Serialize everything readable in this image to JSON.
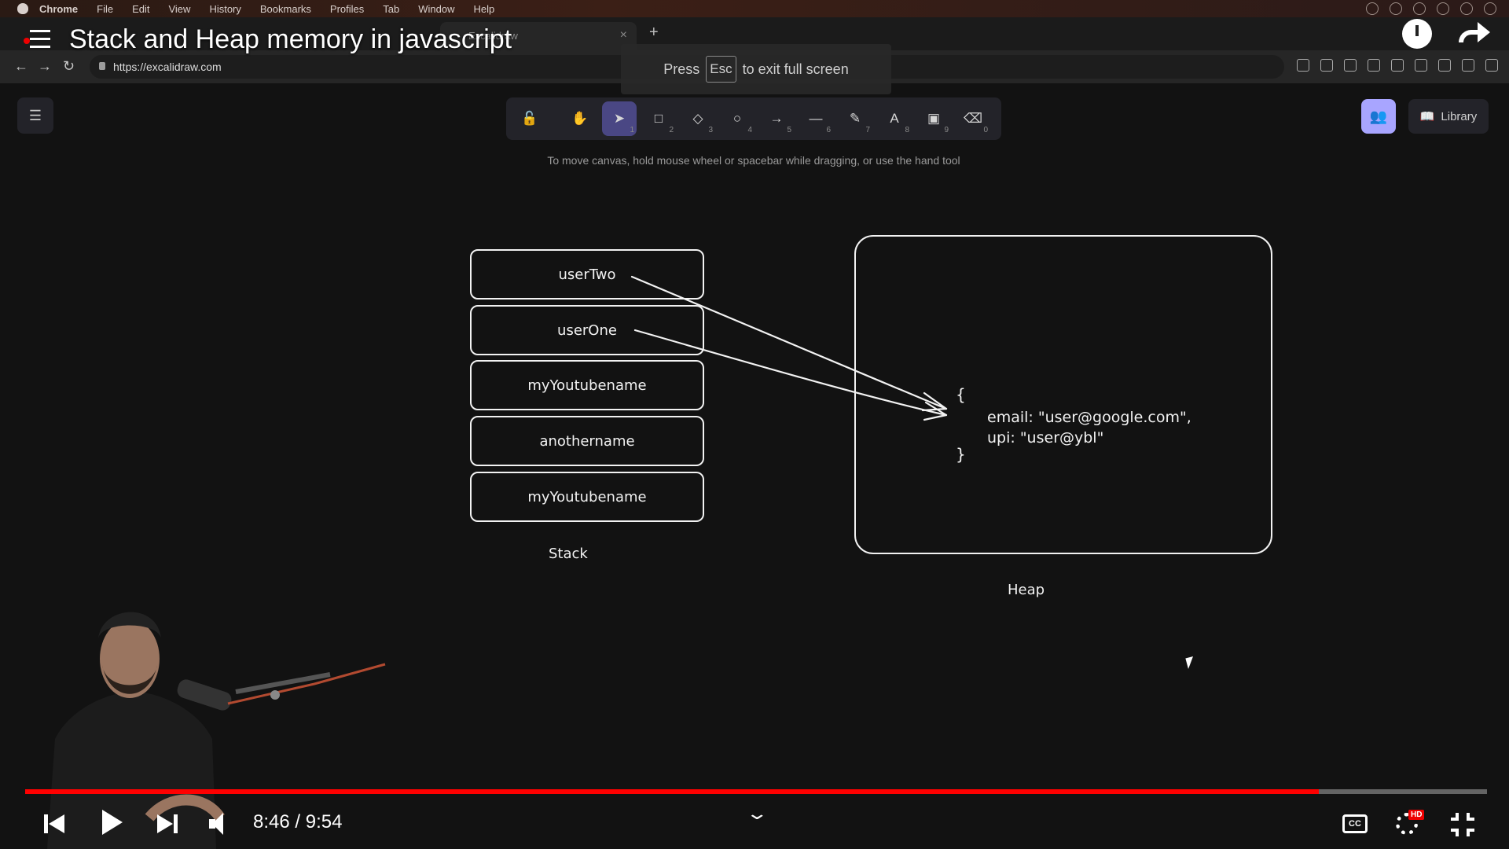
{
  "menubar": {
    "app": "Chrome",
    "items": [
      "File",
      "Edit",
      "View",
      "History",
      "Bookmarks",
      "Profiles",
      "Tab",
      "Window",
      "Help"
    ]
  },
  "browser": {
    "tab_label": "Excalidraw",
    "url": "https://excalidraw.com"
  },
  "fullscreen_hint": {
    "press": "Press",
    "key": "Esc",
    "rest": "to exit full screen"
  },
  "video": {
    "title": "Stack and Heap memory in javascript",
    "time": "8:46 / 9:54",
    "progress": 0.885,
    "hd": "HD",
    "cc": "CC"
  },
  "excalidraw": {
    "tools": [
      {
        "icon": "lock-icon",
        "glyph": "🔓",
        "num": ""
      },
      {
        "icon": "hand-icon",
        "glyph": "✋",
        "num": ""
      },
      {
        "icon": "selection-icon",
        "glyph": "➤",
        "num": "1"
      },
      {
        "icon": "rectangle-icon",
        "glyph": "□",
        "num": "2"
      },
      {
        "icon": "diamond-icon",
        "glyph": "◇",
        "num": "3"
      },
      {
        "icon": "ellipse-icon",
        "glyph": "○",
        "num": "4"
      },
      {
        "icon": "arrow-icon",
        "glyph": "→",
        "num": "5"
      },
      {
        "icon": "line-icon",
        "glyph": "—",
        "num": "6"
      },
      {
        "icon": "pencil-icon",
        "glyph": "✎",
        "num": "7"
      },
      {
        "icon": "text-icon",
        "glyph": "A",
        "num": "8"
      },
      {
        "icon": "image-icon",
        "glyph": "▣",
        "num": "9"
      },
      {
        "icon": "eraser-icon",
        "glyph": "⌫",
        "num": "0"
      }
    ],
    "library_label": "Library",
    "hint": "To move canvas, hold mouse wheel or spacebar while dragging, or use the hand tool"
  },
  "diagram": {
    "stack_items": [
      "userTwo",
      "userOne",
      "myYoutubename",
      "anothername",
      "myYoutubename"
    ],
    "stack_label": "Stack",
    "heap_label": "Heap",
    "heap_open": "{",
    "heap_close": "}",
    "heap_line1": "email: \"user@google.com\",",
    "heap_line2": "upi: \"user@ybl\""
  }
}
